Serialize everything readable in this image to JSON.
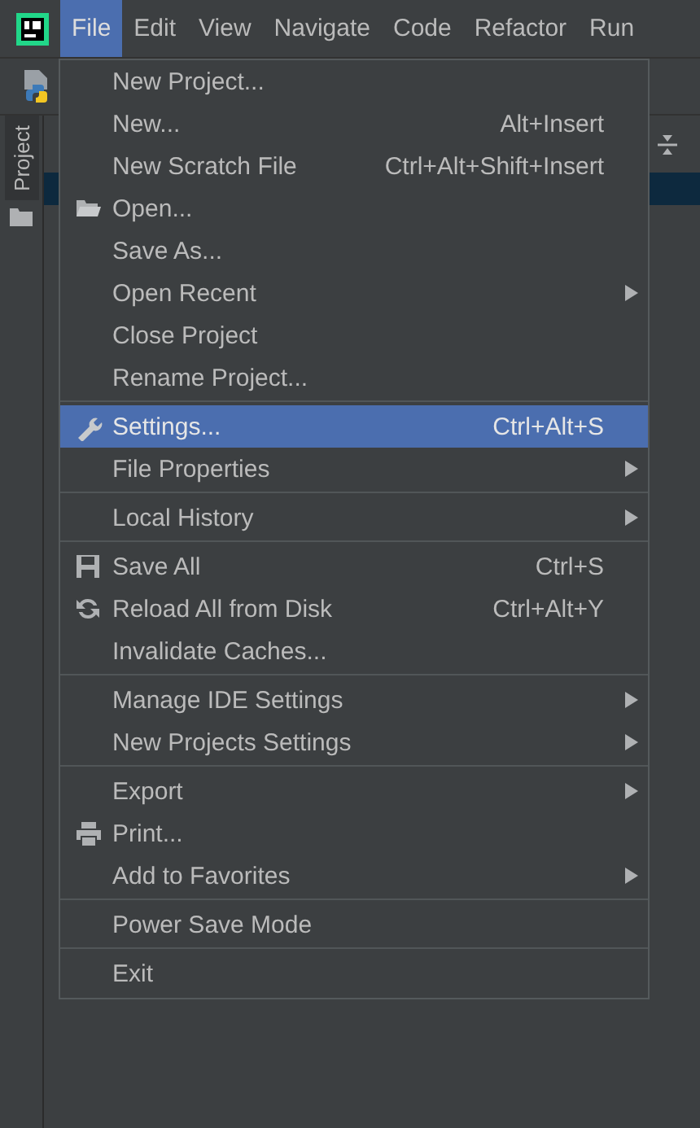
{
  "menu_bar": [
    {
      "label": "File",
      "selected": true
    },
    {
      "label": "Edit",
      "selected": false
    },
    {
      "label": "View",
      "selected": false
    },
    {
      "label": "Navigate",
      "selected": false
    },
    {
      "label": "Code",
      "selected": false
    },
    {
      "label": "Refactor",
      "selected": false
    },
    {
      "label": "Run",
      "selected": false
    }
  ],
  "sidebar": {
    "tabs": [
      {
        "label": "Project"
      }
    ]
  },
  "file_menu": {
    "groups": [
      [
        {
          "label": "New Project...",
          "kind": "plain",
          "selected": false,
          "submenu": false
        },
        {
          "label": "New...",
          "shortcut": "Alt+Insert",
          "kind": "plain",
          "selected": false,
          "submenu": false
        },
        {
          "label": "New Scratch File",
          "shortcut": "Ctrl+Alt+Shift+Insert",
          "kind": "plain",
          "selected": false,
          "submenu": false
        },
        {
          "label": "Open...",
          "kind": "folder",
          "selected": false,
          "submenu": false
        },
        {
          "label": "Save As...",
          "kind": "plain",
          "selected": false,
          "submenu": false
        },
        {
          "label": "Open Recent",
          "kind": "plain",
          "selected": false,
          "submenu": true
        },
        {
          "label": "Close Project",
          "kind": "plain",
          "selected": false,
          "submenu": false
        },
        {
          "label": "Rename Project...",
          "kind": "plain",
          "selected": false,
          "submenu": false
        }
      ],
      [
        {
          "label": "Settings...",
          "shortcut": "Ctrl+Alt+S",
          "kind": "wrench",
          "selected": true,
          "submenu": false
        },
        {
          "label": "File Properties",
          "kind": "plain",
          "selected": false,
          "submenu": true
        }
      ],
      [
        {
          "label": "Local History",
          "kind": "plain",
          "selected": false,
          "submenu": true
        }
      ],
      [
        {
          "label": "Save All",
          "shortcut": "Ctrl+S",
          "kind": "save",
          "selected": false,
          "submenu": false
        },
        {
          "label": "Reload All from Disk",
          "shortcut": "Ctrl+Alt+Y",
          "kind": "reload",
          "selected": false,
          "submenu": false
        },
        {
          "label": "Invalidate Caches...",
          "kind": "plain",
          "selected": false,
          "submenu": false
        }
      ],
      [
        {
          "label": "Manage IDE Settings",
          "kind": "plain",
          "selected": false,
          "submenu": true
        },
        {
          "label": "New Projects Settings",
          "kind": "plain",
          "selected": false,
          "submenu": true
        }
      ],
      [
        {
          "label": "Export",
          "kind": "plain",
          "selected": false,
          "submenu": true
        },
        {
          "label": "Print...",
          "kind": "print",
          "selected": false,
          "submenu": false
        },
        {
          "label": "Add to Favorites",
          "kind": "plain",
          "selected": false,
          "submenu": true
        }
      ],
      [
        {
          "label": "Power Save Mode",
          "kind": "plain",
          "selected": false,
          "submenu": false
        }
      ],
      [
        {
          "label": "Exit",
          "kind": "plain",
          "selected": false,
          "submenu": false
        }
      ]
    ]
  }
}
